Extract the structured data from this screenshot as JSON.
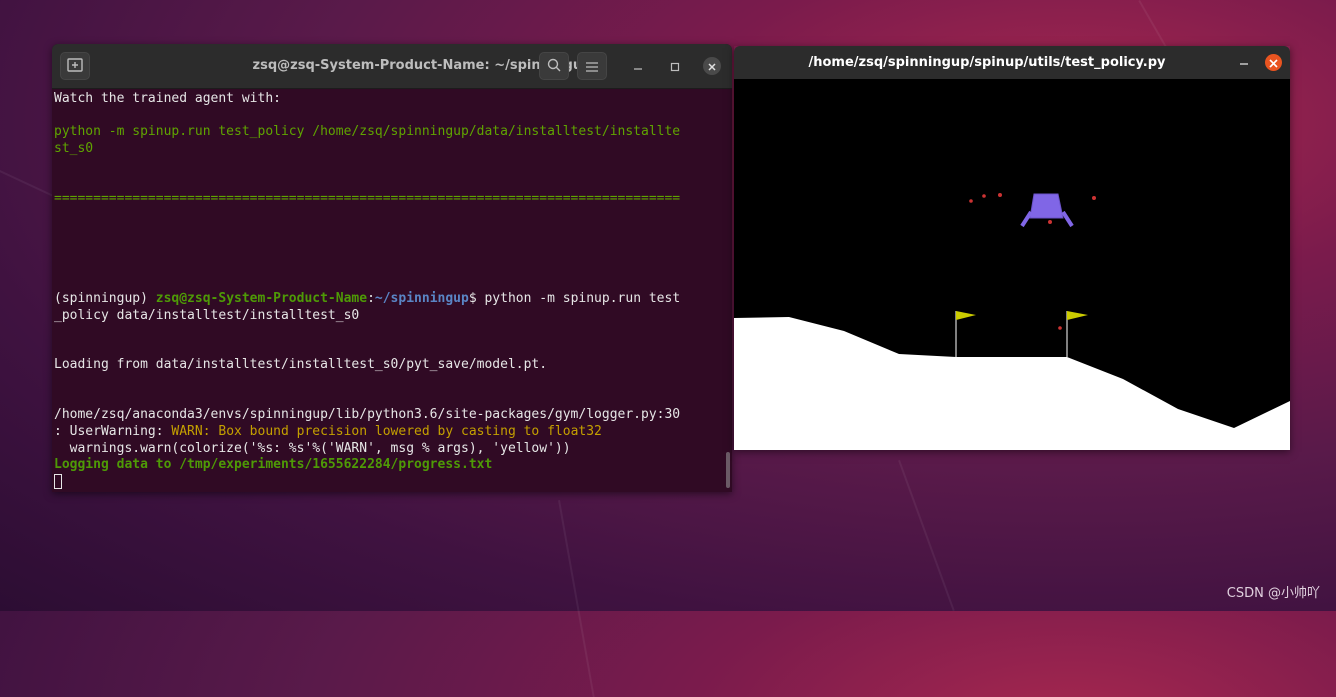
{
  "terminal": {
    "title": "zsq@zsq-System-Product-Name: ~/spinningup",
    "icons": {
      "new_tab": "new-tab-icon",
      "search": "search-icon",
      "menu": "hamburger-menu-icon",
      "minimize": "minimize-icon",
      "maximize": "maximize-icon",
      "close": "close-icon"
    },
    "lines": {
      "l1": "Watch the trained agent with:",
      "l2": "python -m spinup.run test_policy /home/zsq/spinningup/data/installtest/installte",
      "l3": "st_s0",
      "l4": "================================================================================",
      "l5_env": "(spinningup) ",
      "l5_user": "zsq@zsq-System-Product-Name",
      "l5_colon": ":",
      "l5_path": "~/spinningup",
      "l5_cmd": "$ python -m spinup.run test",
      "l6": "_policy data/installtest/installtest_s0",
      "l7": "Loading from data/installtest/installtest_s0/pyt_save/model.pt.",
      "l8": "/home/zsq/anaconda3/envs/spinningup/lib/python3.6/site-packages/gym/logger.py:30",
      "l9_pre": ": UserWarning: ",
      "l9_warn": "WARN: Box bound precision lowered by casting to float32",
      "l10": "  warnings.warn(colorize('%s: %s'%('WARN', msg % args), 'yellow'))",
      "l11": "Logging data to /tmp/experiments/1655622284/progress.txt"
    }
  },
  "lander_window": {
    "title": "/home/zsq/spinningup/spinup/utils/test_policy.py",
    "colors": {
      "sky": "#000000",
      "ground": "#ffffff",
      "lander": "#8066e6",
      "flag": "#cccc00",
      "particle": "#cc3333"
    }
  },
  "watermark": "CSDN @小帅吖"
}
